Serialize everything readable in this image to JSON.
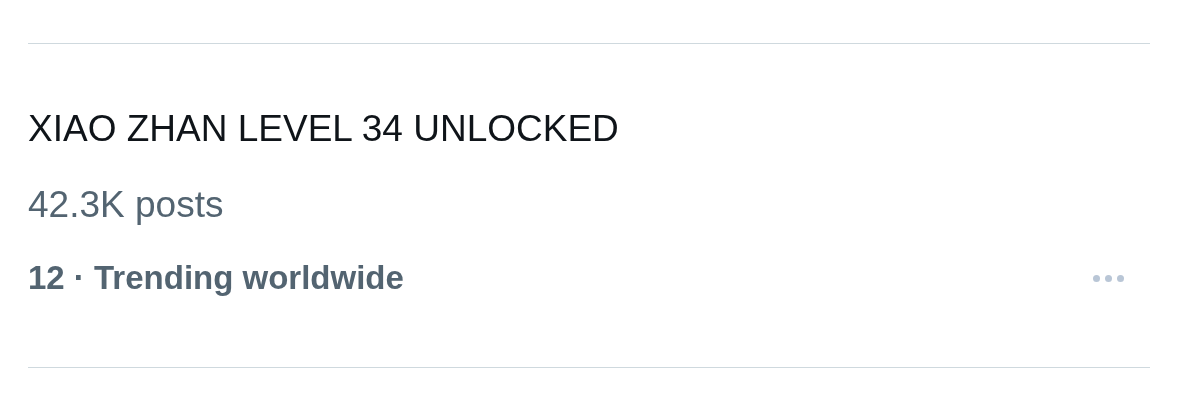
{
  "trend": {
    "title": "XIAO ZHAN LEVEL 34 UNLOCKED",
    "post_count": "42.3K posts",
    "context": "12 · Trending worldwide"
  }
}
